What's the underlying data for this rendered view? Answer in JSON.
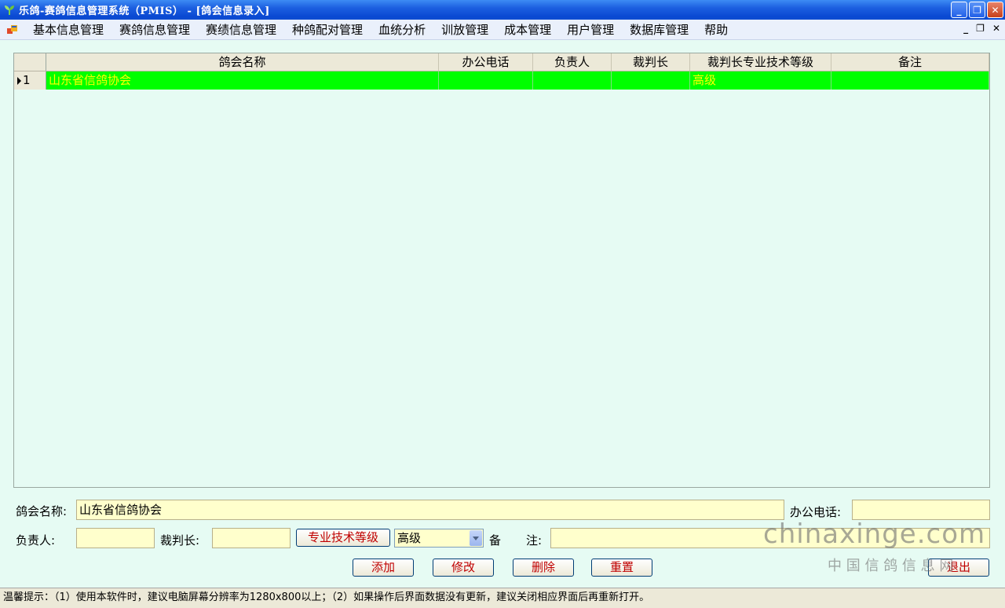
{
  "window": {
    "title": "乐鸽-赛鸽信息管理系统（PMIS） - [鸽会信息录入]"
  },
  "menu": {
    "items": [
      "基本信息管理",
      "赛鸽信息管理",
      "赛绩信息管理",
      "种鸽配对管理",
      "血统分析",
      "训放管理",
      "成本管理",
      "用户管理",
      "数据库管理",
      "帮助"
    ]
  },
  "grid": {
    "columns": [
      "鸽会名称",
      "办公电话",
      "负责人",
      "裁判长",
      "裁判长专业技术等级",
      "备注"
    ],
    "rows": [
      {
        "index": "1",
        "name": "山东省信鸽协会",
        "phone": "",
        "leader": "",
        "judge": "",
        "level": "高级",
        "note": ""
      }
    ]
  },
  "form": {
    "name_label": "鸽会名称:",
    "name_value": "山东省信鸽协会",
    "phone_label": "办公电话:",
    "phone_value": "",
    "leader_label": "负责人:",
    "leader_value": "",
    "judge_label": "裁判长:",
    "judge_value": "",
    "level_button": "专业技术等级",
    "level_value": "高级",
    "note_label_1": "备",
    "note_label_2": "注:",
    "note_value": ""
  },
  "actions": {
    "add": "添加",
    "modify": "修改",
    "delete": "删除",
    "reset": "重置",
    "exit": "退出"
  },
  "watermark": {
    "domain": "chinaxinge.com",
    "name": "中 国 信 鸽 信 息 网"
  },
  "status": {
    "text": "温馨提示：（1）使用本软件时，建议电脑屏幕分辨率为1280x800以上；（2）如果操作后界面数据没有更新，建议关闭相应界面后再重新打开。"
  },
  "colors": {
    "selected_row_bg": "#00ff00",
    "selected_row_text": "#ffff00",
    "input_bg": "#ffffcc",
    "button_text": "#c00000"
  }
}
